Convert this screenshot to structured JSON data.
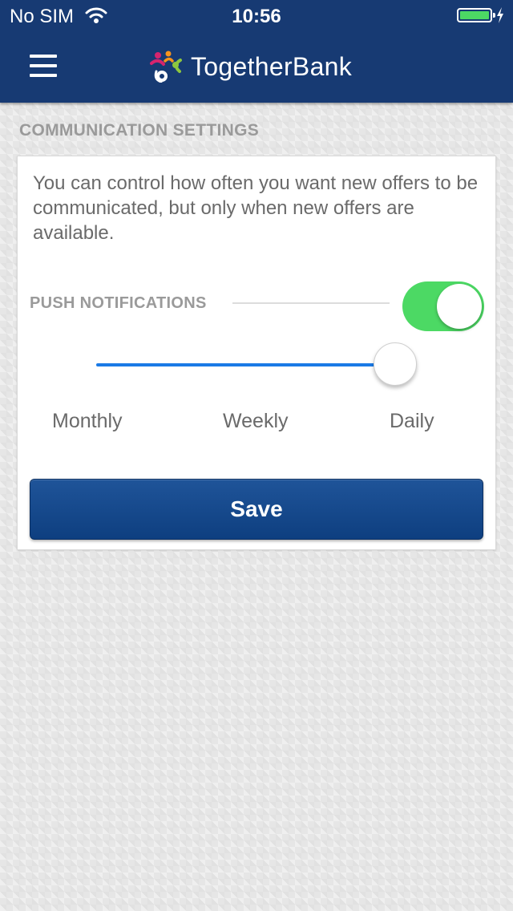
{
  "status_bar": {
    "carrier": "No SIM",
    "time": "10:56",
    "battery_color": "#4cd964"
  },
  "header": {
    "menu_icon": "hamburger-icon",
    "brand_name": "TogetherBank",
    "bar_color": "#173a73"
  },
  "settings": {
    "section_title": "COMMUNICATION SETTINGS",
    "description": "You can control how often you want new offers to be communicated, but only when new offers are available.",
    "push_notifications": {
      "label": "PUSH NOTIFICATIONS",
      "enabled": true,
      "on_color": "#4cd964"
    },
    "frequency": {
      "options": [
        "Monthly",
        "Weekly",
        "Daily"
      ],
      "selected": "Daily",
      "track_color": "#1a7ae6"
    },
    "save_label": "Save"
  }
}
